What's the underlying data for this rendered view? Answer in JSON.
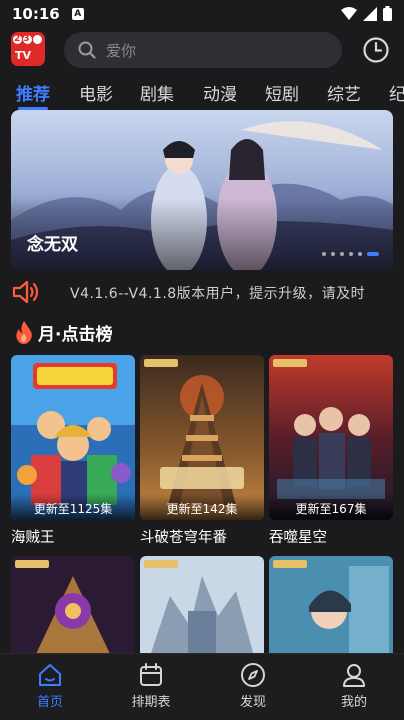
{
  "status": {
    "time": "10:16",
    "notif_icon": "A"
  },
  "header": {
    "logo_top": "23",
    "logo_bottom": "TV",
    "search_placeholder": "爱你"
  },
  "tabs": [
    {
      "label": "推荐",
      "active": true
    },
    {
      "label": "电影"
    },
    {
      "label": "剧集"
    },
    {
      "label": "动漫"
    },
    {
      "label": "短剧"
    },
    {
      "label": "综艺"
    },
    {
      "label": "纪"
    }
  ],
  "banner": {
    "title": "念无双",
    "page_count": 6,
    "current_page": 6
  },
  "notice": {
    "text": "V4.1.6--V4.1.8版本用户，提示升级，请及时"
  },
  "section": {
    "title": "月·点击榜"
  },
  "cards_row1": [
    {
      "name": "海贼王",
      "update": "更新至1125集"
    },
    {
      "name": "斗破苍穹年番",
      "update": "更新至142集"
    },
    {
      "name": "吞噬星空",
      "update": "更新至167集"
    }
  ],
  "bottom_nav": [
    {
      "label": "首页",
      "icon": "home-icon",
      "active": true
    },
    {
      "label": "排期表",
      "icon": "calendar-icon"
    },
    {
      "label": "发现",
      "icon": "compass-icon"
    },
    {
      "label": "我的",
      "icon": "user-icon"
    }
  ],
  "colors": {
    "accent": "#3d7dff",
    "background": "#1b1b1d",
    "brand_red": "#e02a2a",
    "notice_icon": "#ff5b3a"
  }
}
